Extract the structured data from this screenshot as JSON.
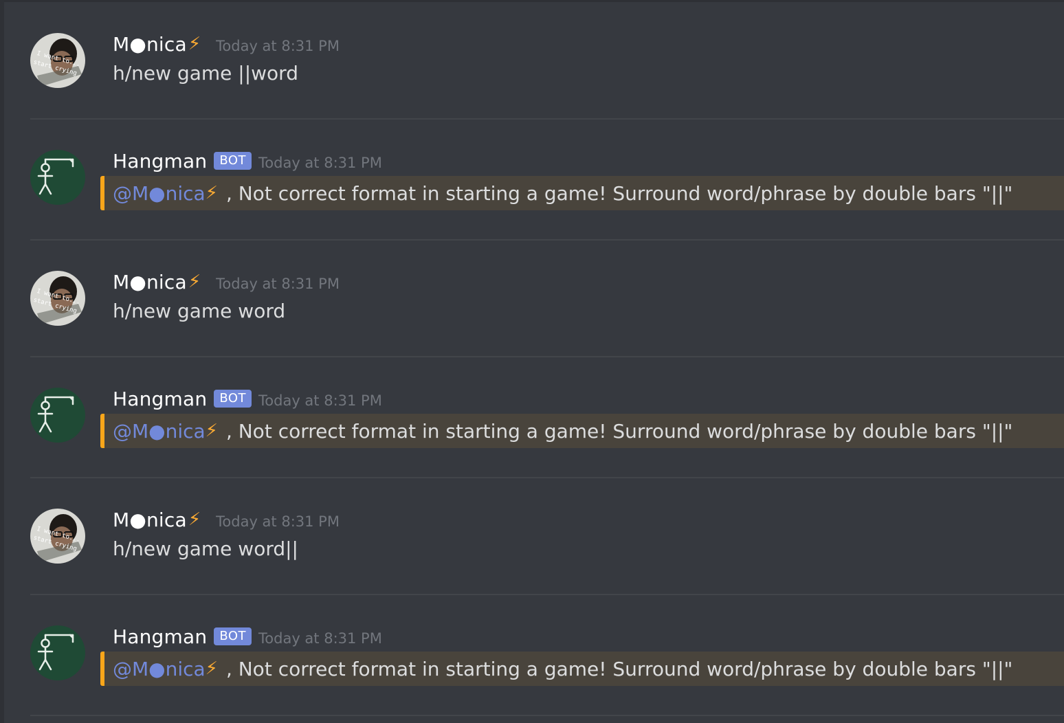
{
  "messages": [
    {
      "author": "M●nica",
      "author_emoji": "⚡",
      "is_bot": false,
      "timestamp": "Today at 8:31 PM",
      "content": "h/new game ||word",
      "avatar_icon": "user-avatar-meme-icon",
      "avatar_caption": "I want to... start crying"
    },
    {
      "author": "Hangman",
      "is_bot": true,
      "bot_tag": "BOT",
      "timestamp": "Today at 8:31 PM",
      "mention": "@M●nica",
      "mention_emoji": "⚡",
      "content": ", Not correct format in starting a game! Surround word/phrase by double bars \"||\"",
      "avatar_icon": "hangman-gallows-icon"
    },
    {
      "author": "M●nica",
      "author_emoji": "⚡",
      "is_bot": false,
      "timestamp": "Today at 8:31 PM",
      "content": "h/new game word",
      "avatar_icon": "user-avatar-meme-icon",
      "avatar_caption": "I want to... start crying"
    },
    {
      "author": "Hangman",
      "is_bot": true,
      "bot_tag": "BOT",
      "timestamp": "Today at 8:31 PM",
      "mention": "@M●nica",
      "mention_emoji": "⚡",
      "content": ", Not correct format in starting a game! Surround word/phrase by double bars \"||\"",
      "avatar_icon": "hangman-gallows-icon"
    },
    {
      "author": "M●nica",
      "author_emoji": "⚡",
      "is_bot": false,
      "timestamp": "Today at 8:31 PM",
      "content": "h/new game word||",
      "avatar_icon": "user-avatar-meme-icon",
      "avatar_caption": "I want to... start crying"
    },
    {
      "author": "Hangman",
      "is_bot": true,
      "bot_tag": "BOT",
      "timestamp": "Today at 8:31 PM",
      "mention": "@M●nica",
      "mention_emoji": "⚡",
      "content": ", Not correct format in starting a game! Surround word/phrase by double bars \"||\"",
      "avatar_icon": "hangman-gallows-icon"
    }
  ],
  "colors": {
    "background": "#36393f",
    "mention_highlight": "#49443c",
    "mention_bar": "#faa61a",
    "mention_text": "#7289da",
    "bot_tag": "#7289da",
    "timestamp": "#72767d"
  }
}
